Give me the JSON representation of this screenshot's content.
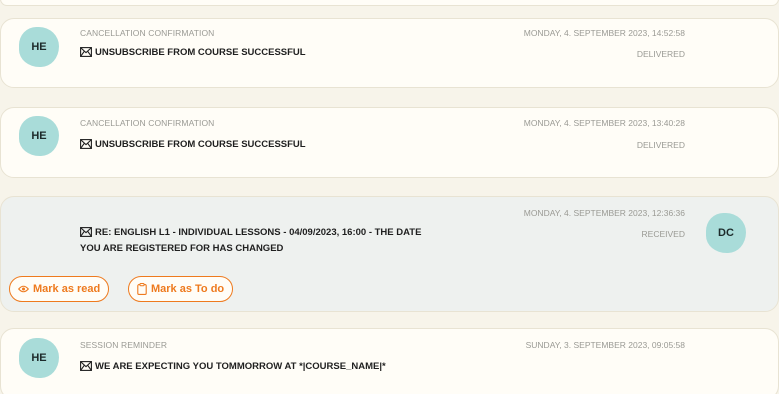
{
  "messages": [
    {
      "avatar": "HE",
      "category": "CANCELLATION CONFIRMATION",
      "subject": "UNSUBSCRIBE FROM COURSE SUCCESSFUL",
      "date": "MONDAY, 4. SEPTEMBER 2023, 14:52:58",
      "status": "DELIVERED"
    },
    {
      "avatar": "HE",
      "category": "CANCELLATION CONFIRMATION",
      "subject": "UNSUBSCRIBE FROM COURSE SUCCESSFUL",
      "date": "MONDAY, 4. SEPTEMBER 2023, 13:40:28",
      "status": "DELIVERED"
    },
    {
      "avatar": "DC",
      "subject_line1": "RE: ENGLISH L1 - INDIVIDUAL LESSONS - 04/09/2023, 16:00 - THE DATE",
      "subject_line2": "YOU ARE REGISTERED FOR HAS CHANGED",
      "date": "MONDAY, 4. SEPTEMBER 2023, 12:36:36",
      "status": "RECEIVED",
      "actions": {
        "mark_read": "Mark as read",
        "mark_todo": "Mark as To do"
      }
    },
    {
      "avatar": "HE",
      "category": "SESSION REMINDER",
      "subject": "WE ARE EXPECTING YOU TOMMORROW AT *|COURSE_NAME|*",
      "date": "SUNDAY, 3. SEPTEMBER 2023, 09:05:58",
      "status": ""
    }
  ],
  "colors": {
    "accent": "#ee7a1e",
    "avatar": "#a9dcd9",
    "page_bg": "#f7f4ea",
    "card_bg": "#fffdf7",
    "received_bg": "#eef1ef",
    "muted_text": "#9a9a94"
  },
  "icons": [
    "envelope-icon",
    "eye-icon",
    "clipboard-icon"
  ]
}
